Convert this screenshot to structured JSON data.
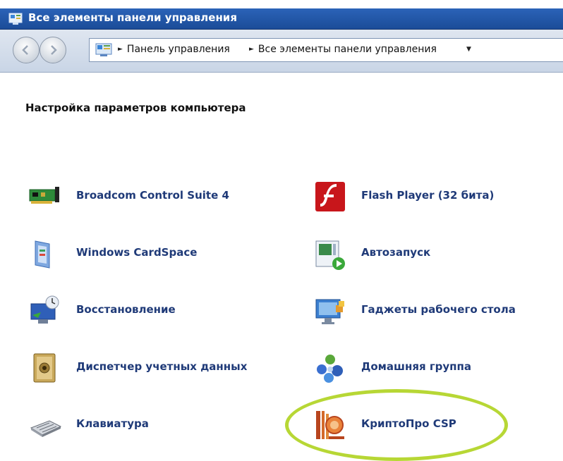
{
  "window": {
    "title": "Все элементы панели управления"
  },
  "address_bar": {
    "breadcrumbs": [
      "Панель управления",
      "Все элементы панели управления"
    ]
  },
  "main": {
    "heading": "Настройка параметров компьютера",
    "items": [
      {
        "label": "Broadcom Control Suite 4",
        "icon": "network-card-icon"
      },
      {
        "label": "Flash Player (32 бита)",
        "icon": "flash-player-icon"
      },
      {
        "label": "Windows CardSpace",
        "icon": "cardspace-icon"
      },
      {
        "label": "Автозапуск",
        "icon": "autoplay-icon"
      },
      {
        "label": "Восстановление",
        "icon": "recovery-icon"
      },
      {
        "label": "Гаджеты рабочего стола",
        "icon": "desktop-gadgets-icon"
      },
      {
        "label": "Диспетчер учетных данных",
        "icon": "credential-manager-icon"
      },
      {
        "label": "Домашняя группа",
        "icon": "homegroup-icon"
      },
      {
        "label": "Клавиатура",
        "icon": "keyboard-icon"
      },
      {
        "label": "КриптоПро CSP",
        "icon": "cryptopro-icon"
      }
    ]
  },
  "colors": {
    "title_bar": "#1f54a3",
    "item_label": "#1f3a78",
    "highlight_ring": "#b7d735"
  }
}
